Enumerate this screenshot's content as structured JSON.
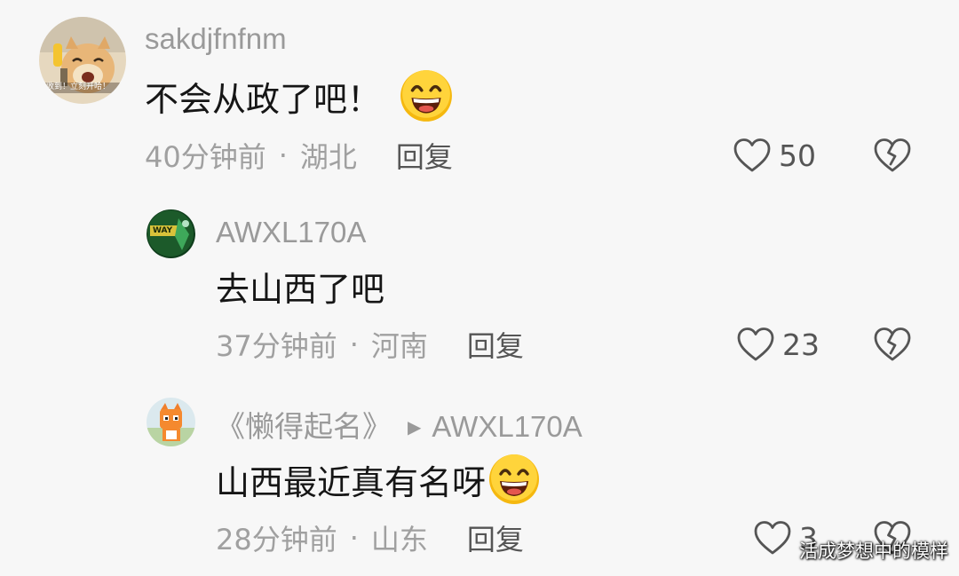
{
  "comments": [
    {
      "username": "sakdjfnfnm",
      "text": "不会从政了吧！",
      "time": "40分钟前",
      "location": "湖北",
      "reply_label": "回复",
      "likes": "50",
      "avatar_caption": "收到！立刻开哈！"
    },
    {
      "username": "AWXL170A",
      "text": "去山西了吧",
      "time": "37分钟前",
      "location": "河南",
      "reply_label": "回复",
      "likes": "23",
      "avatar_caption": "WAY"
    },
    {
      "username": "《懒得起名》",
      "reply_to": "AWXL170A",
      "text": "山西最近真有名呀",
      "time": "28分钟前",
      "location": "山东",
      "reply_label": "回复",
      "likes": "3"
    }
  ],
  "separator": "·",
  "watermark": "活成梦想中的模样",
  "colors": {
    "background": "#f7f7f7",
    "username": "#9a9a9a",
    "text": "#161616",
    "meta": "#a0a0a0"
  },
  "icons": [
    "grinning-emoji-icon",
    "heart-outline-icon",
    "broken-heart-icon",
    "reply-arrow-icon"
  ]
}
